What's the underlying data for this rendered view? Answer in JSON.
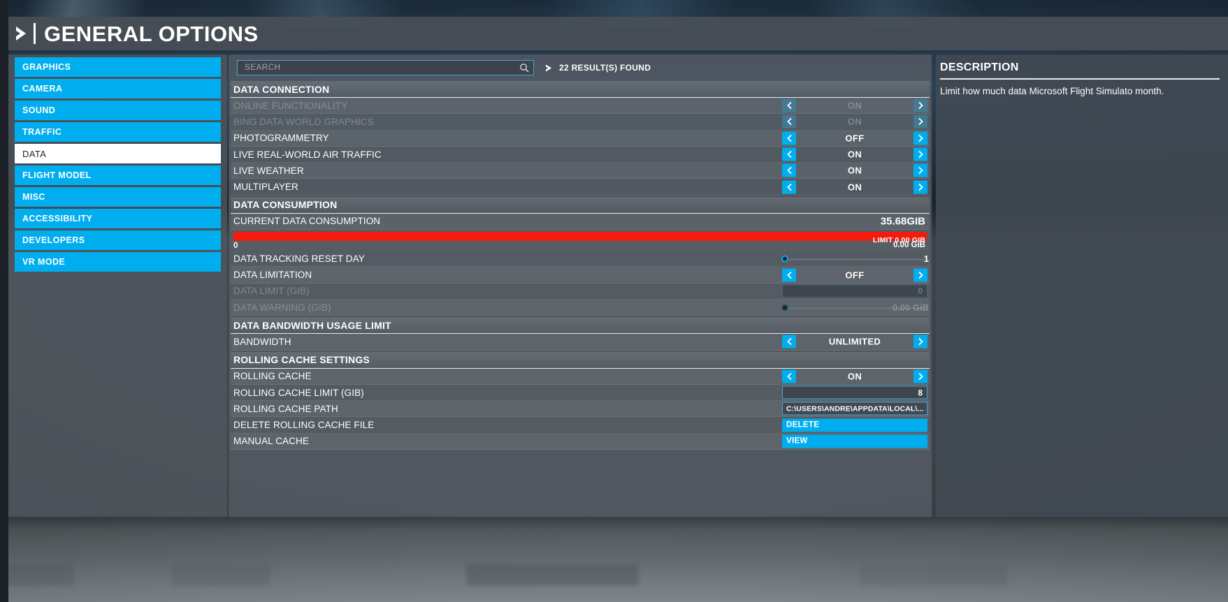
{
  "header": {
    "title": "GENERAL OPTIONS",
    "arrow_icon": "chevron-right-icon"
  },
  "sidebar": {
    "items": [
      {
        "label": "GRAPHICS",
        "active": false
      },
      {
        "label": "CAMERA",
        "active": false
      },
      {
        "label": "SOUND",
        "active": false
      },
      {
        "label": "TRAFFIC",
        "active": false
      },
      {
        "label": "DATA",
        "active": true
      },
      {
        "label": "FLIGHT MODEL",
        "active": false
      },
      {
        "label": "MISC",
        "active": false
      },
      {
        "label": "ACCESSIBILITY",
        "active": false
      },
      {
        "label": "DEVELOPERS",
        "active": false
      },
      {
        "label": "VR MODE",
        "active": false
      }
    ]
  },
  "search": {
    "placeholder": "SEARCH",
    "value": "",
    "icon": "magnifier-icon",
    "results_label": "22 RESULT(S) FOUND",
    "results_arrow_icon": "chevron-right-icon"
  },
  "sections": [
    {
      "title": "DATA CONNECTION",
      "rows": [
        {
          "label": "ONLINE FUNCTIONALITY",
          "type": "spinner",
          "value": "ON",
          "disabled": true
        },
        {
          "label": "BING DATA WORLD GRAPHICS",
          "type": "spinner",
          "value": "ON",
          "disabled": true
        },
        {
          "label": "PHOTOGRAMMETRY",
          "type": "spinner",
          "value": "OFF",
          "disabled": false
        },
        {
          "label": "LIVE REAL-WORLD AIR TRAFFIC",
          "type": "spinner",
          "value": "ON",
          "disabled": false
        },
        {
          "label": "LIVE WEATHER",
          "type": "spinner",
          "value": "ON",
          "disabled": false
        },
        {
          "label": "MULTIPLAYER",
          "type": "spinner",
          "value": "ON",
          "disabled": false
        }
      ]
    },
    {
      "title": "DATA CONSUMPTION",
      "rows": [
        {
          "label": "CURRENT DATA CONSUMPTION",
          "type": "value",
          "value": "35.68GIB",
          "disabled": false
        },
        {
          "label": "",
          "type": "meter",
          "limit_text": "LIMIT 0.00 GIB",
          "zero_text": "0",
          "used_text": "0.00 GiB",
          "bar_color": "#f21b0c",
          "fill_percent": 100
        },
        {
          "label": "DATA TRACKING RESET DAY",
          "type": "slider",
          "value": "1",
          "knob_percent": 2,
          "disabled": false
        },
        {
          "label": "DATA LIMITATION",
          "type": "spinner",
          "value": "OFF",
          "disabled": false
        },
        {
          "label": "DATA LIMIT (GIB)",
          "type": "input",
          "value": "0",
          "disabled": true
        },
        {
          "label": "DATA WARNING (GIB)",
          "type": "slider",
          "value": "0.00 GiB",
          "knob_percent": 2,
          "disabled": true
        }
      ]
    },
    {
      "title": "DATA BANDWIDTH USAGE LIMIT",
      "rows": [
        {
          "label": "BANDWIDTH",
          "type": "spinner",
          "value": "UNLIMITED",
          "disabled": false
        }
      ]
    },
    {
      "title": "ROLLING CACHE SETTINGS",
      "rows": [
        {
          "label": "ROLLING CACHE",
          "type": "spinner",
          "value": "ON",
          "disabled": false
        },
        {
          "label": "ROLLING CACHE LIMIT (GIB)",
          "type": "input",
          "value": "8",
          "disabled": false
        },
        {
          "label": "ROLLING CACHE PATH",
          "type": "path",
          "value": "C:\\USERS\\ANDRE\\APPDATA\\LOCAL\\...",
          "disabled": false
        },
        {
          "label": "DELETE ROLLING CACHE FILE",
          "type": "button",
          "value": "DELETE",
          "disabled": false
        },
        {
          "label": "MANUAL CACHE",
          "type": "button",
          "value": "VIEW",
          "disabled": false
        }
      ]
    }
  ],
  "description": {
    "title": "DESCRIPTION",
    "body": "Limit how much data Microsoft Flight Simulato month."
  },
  "colors": {
    "accent": "#00aeef",
    "alert": "#f21b0c",
    "panel": "#565d64",
    "text": "#ffffff"
  }
}
